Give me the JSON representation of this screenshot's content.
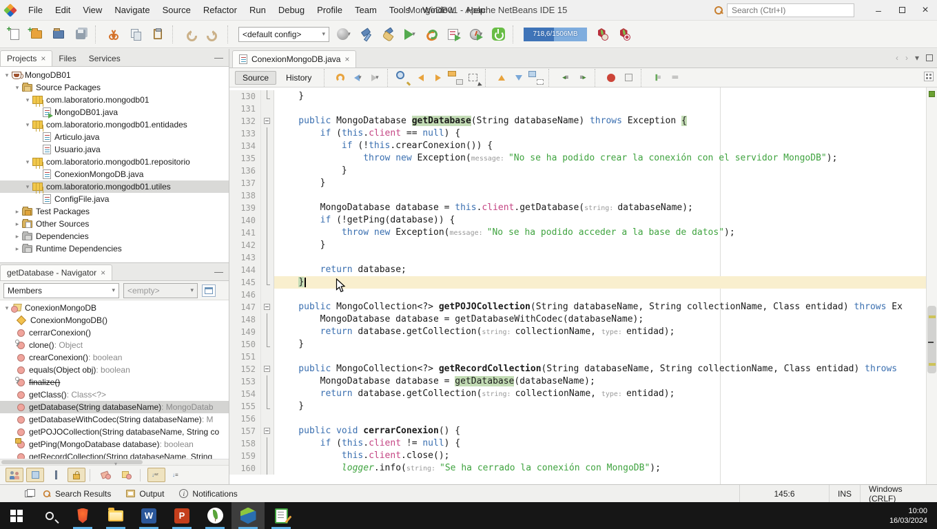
{
  "window": {
    "title": "MongoDB01 - Apache NetBeans IDE 15",
    "search_placeholder": "Search (Ctrl+I)"
  },
  "menu": {
    "items": [
      "File",
      "Edit",
      "View",
      "Navigate",
      "Source",
      "Refactor",
      "Run",
      "Debug",
      "Profile",
      "Team",
      "Tools",
      "Window",
      "Help"
    ]
  },
  "toolbar": {
    "config_value": "<default config>",
    "memory_text": "718,6/1506MB",
    "memory_fill_pct": 48,
    "icons": [
      "new-file",
      "new-project",
      "open-project",
      "save-all",
      "cut",
      "copy",
      "paste",
      "undo",
      "redo",
      "web-deploy",
      "build",
      "clean-build",
      "run",
      "rerun",
      "debug",
      "profile",
      "springboot",
      "mongo-start",
      "mongo-stop"
    ]
  },
  "projects_panel": {
    "tabs": [
      "Projects",
      "Files",
      "Services"
    ],
    "active_tab": "Projects",
    "tree": [
      {
        "indent": 0,
        "chevron": "open",
        "icon": "project",
        "label": "MongoDB01"
      },
      {
        "indent": 1,
        "chevron": "open",
        "icon": "src-folder",
        "label": "Source Packages"
      },
      {
        "indent": 2,
        "chevron": "open",
        "icon": "package",
        "label": "com.laboratorio.mongodb01"
      },
      {
        "indent": 3,
        "icon": "java-main",
        "label": "MongoDB01.java"
      },
      {
        "indent": 2,
        "chevron": "open",
        "icon": "package",
        "label": "com.laboratorio.mongodb01.entidades"
      },
      {
        "indent": 3,
        "icon": "java",
        "label": "Articulo.java"
      },
      {
        "indent": 3,
        "icon": "java",
        "label": "Usuario.java"
      },
      {
        "indent": 2,
        "chevron": "open",
        "icon": "package",
        "label": "com.laboratorio.mongodb01.repositorio"
      },
      {
        "indent": 3,
        "icon": "java",
        "label": "ConexionMongoDB.java"
      },
      {
        "indent": 2,
        "chevron": "open",
        "icon": "package",
        "label": "com.laboratorio.mongodb01.utiles",
        "selected": true
      },
      {
        "indent": 3,
        "icon": "java",
        "label": "ConfigFile.java"
      },
      {
        "indent": 1,
        "chevron": "closed",
        "icon": "test-folder",
        "label": "Test Packages"
      },
      {
        "indent": 1,
        "chevron": "closed",
        "icon": "other-folder",
        "label": "Other Sources"
      },
      {
        "indent": 1,
        "chevron": "closed",
        "icon": "deps",
        "label": "Dependencies"
      },
      {
        "indent": 1,
        "chevron": "closed",
        "icon": "deps",
        "label": "Runtime Dependencies"
      }
    ]
  },
  "navigator": {
    "tab_title": "getDatabase - Navigator",
    "filter_value": "Members",
    "secondary_value": "<empty>",
    "items": [
      {
        "icon": "class",
        "label": "ConexionMongoDB",
        "chevron": true
      },
      {
        "icon": "constructor",
        "label": "ConexionMongoDB()"
      },
      {
        "icon": "method",
        "label": "cerrarConexion()"
      },
      {
        "icon": "method-prot",
        "label": "clone()",
        "type": " : Object"
      },
      {
        "icon": "method",
        "label": "crearConexion()",
        "type": " : boolean"
      },
      {
        "icon": "method",
        "label": "equals(Object obj)",
        "type": " : boolean"
      },
      {
        "icon": "method-prot",
        "label": "finalize()",
        "strike": true
      },
      {
        "icon": "method",
        "label": "getClass()",
        "type": " : Class<?>"
      },
      {
        "icon": "method",
        "label": "getDatabase(String databaseName)",
        "type": " : MongoDatab",
        "selected": true
      },
      {
        "icon": "method",
        "label": "getDatabaseWithCodec(String databaseName)",
        "type": " : M"
      },
      {
        "icon": "method",
        "label": "getPOJOCollection(String databaseName, String co"
      },
      {
        "icon": "method-priv",
        "label": "getPing(MongoDatabase database)",
        "type": " : boolean"
      },
      {
        "icon": "method",
        "label": "getRecordCollection(String databaseName, String"
      }
    ],
    "filters": [
      {
        "name": "show-inherited",
        "pressed": true
      },
      {
        "name": "show-fields",
        "pressed": true
      },
      {
        "name": "show-static",
        "pressed": false
      },
      {
        "name": "show-non-public",
        "pressed": true
      },
      {
        "name": "filter-erasure",
        "pressed": false
      },
      {
        "name": "filter-inner-classes",
        "pressed": false
      },
      {
        "name": "sort-alphabetically",
        "pressed": true
      },
      {
        "name": "sort-by-source",
        "pressed": false
      }
    ]
  },
  "editor": {
    "tab_title": "ConexionMongoDB.java",
    "source_label": "Source",
    "history_label": "History",
    "lines": [
      {
        "n": 130,
        "f": "end",
        "t": [
          [
            "p",
            "    }"
          ]
        ]
      },
      {
        "n": 131,
        "t": []
      },
      {
        "n": 132,
        "f": "start",
        "t": [
          [
            "k",
            "    public"
          ],
          [
            "p",
            " MongoDatabase "
          ],
          [
            "b hl",
            "getDatabase"
          ],
          [
            "p",
            "(String databaseName) "
          ],
          [
            "k",
            "throws"
          ],
          [
            "p",
            " Exception "
          ],
          [
            "hl",
            "{"
          ]
        ]
      },
      {
        "n": 133,
        "f": "line",
        "t": [
          [
            "k",
            "        if"
          ],
          [
            "p",
            " ("
          ],
          [
            "k",
            "this"
          ],
          [
            "p",
            "."
          ],
          [
            "f",
            "client"
          ],
          [
            "p",
            " == "
          ],
          [
            "k",
            "null"
          ],
          [
            "p",
            ") {"
          ]
        ]
      },
      {
        "n": 134,
        "f": "line",
        "t": [
          [
            "k",
            "            if"
          ],
          [
            "p",
            " (!"
          ],
          [
            "k",
            "this"
          ],
          [
            "p",
            ".crearConexion()) {"
          ]
        ]
      },
      {
        "n": 135,
        "f": "line",
        "t": [
          [
            "k",
            "                throw"
          ],
          [
            "p",
            " "
          ],
          [
            "k",
            "new"
          ],
          [
            "p",
            " Exception("
          ],
          [
            "h",
            "message: "
          ],
          [
            "s",
            "\"No se ha podido crear la conexión con el servidor MongoDB\""
          ],
          [
            "p",
            ");"
          ]
        ]
      },
      {
        "n": 136,
        "f": "line",
        "t": [
          [
            "p",
            "            }"
          ]
        ]
      },
      {
        "n": 137,
        "f": "line",
        "t": [
          [
            "p",
            "        }"
          ]
        ]
      },
      {
        "n": 138,
        "f": "line",
        "t": []
      },
      {
        "n": 139,
        "f": "line",
        "t": [
          [
            "p",
            "        MongoDatabase database = "
          ],
          [
            "k",
            "this"
          ],
          [
            "p",
            "."
          ],
          [
            "f",
            "client"
          ],
          [
            "p",
            ".getDatabase("
          ],
          [
            "h",
            "string: "
          ],
          [
            "p",
            "databaseName);"
          ]
        ]
      },
      {
        "n": 140,
        "f": "line",
        "t": [
          [
            "k",
            "        if"
          ],
          [
            "p",
            " (!getPing(database)) {"
          ]
        ]
      },
      {
        "n": 141,
        "f": "line",
        "t": [
          [
            "k",
            "            throw"
          ],
          [
            "p",
            " "
          ],
          [
            "k",
            "new"
          ],
          [
            "p",
            " Exception("
          ],
          [
            "h",
            "message: "
          ],
          [
            "s",
            "\"No se ha podido acceder a la base de datos\""
          ],
          [
            "p",
            ");"
          ]
        ]
      },
      {
        "n": 142,
        "f": "line",
        "t": [
          [
            "p",
            "        }"
          ]
        ]
      },
      {
        "n": 143,
        "f": "line",
        "t": []
      },
      {
        "n": 144,
        "f": "line",
        "t": [
          [
            "k",
            "        return"
          ],
          [
            "p",
            " database;"
          ]
        ]
      },
      {
        "n": 145,
        "f": "end",
        "cur": true,
        "t": [
          [
            "p",
            "    "
          ],
          [
            "hl",
            "}"
          ]
        ]
      },
      {
        "n": 146,
        "t": []
      },
      {
        "n": 147,
        "f": "start",
        "t": [
          [
            "k",
            "    public"
          ],
          [
            "p",
            " MongoCollection<?> "
          ],
          [
            "b",
            "getPOJOCollection"
          ],
          [
            "p",
            "(String databaseName, String collectionName, Class entidad) "
          ],
          [
            "k",
            "throws"
          ],
          [
            "p",
            " Ex"
          ]
        ]
      },
      {
        "n": 148,
        "f": "line",
        "t": [
          [
            "p",
            "        MongoDatabase database = getDatabaseWithCodec(databaseName);"
          ]
        ]
      },
      {
        "n": 149,
        "f": "line",
        "t": [
          [
            "k",
            "        return"
          ],
          [
            "p",
            " database.getCollection("
          ],
          [
            "h",
            "string: "
          ],
          [
            "p",
            "collectionName, "
          ],
          [
            "h",
            "type: "
          ],
          [
            "p",
            "entidad);"
          ]
        ]
      },
      {
        "n": 150,
        "f": "end",
        "t": [
          [
            "p",
            "    }"
          ]
        ]
      },
      {
        "n": 151,
        "t": []
      },
      {
        "n": 152,
        "f": "start",
        "t": [
          [
            "k",
            "    public"
          ],
          [
            "p",
            " MongoCollection<?> "
          ],
          [
            "b",
            "getRecordCollection"
          ],
          [
            "p",
            "(String databaseName, String collectionName, Class entidad) "
          ],
          [
            "k",
            "throws"
          ]
        ]
      },
      {
        "n": 153,
        "f": "line",
        "t": [
          [
            "p",
            "        MongoDatabase database = "
          ],
          [
            "hl",
            "getDatabase"
          ],
          [
            "p",
            "(databaseName);"
          ]
        ]
      },
      {
        "n": 154,
        "f": "line",
        "t": [
          [
            "k",
            "        return"
          ],
          [
            "p",
            " database.getCollection("
          ],
          [
            "h",
            "string: "
          ],
          [
            "p",
            "collectionName, "
          ],
          [
            "h",
            "type: "
          ],
          [
            "p",
            "entidad);"
          ]
        ]
      },
      {
        "n": 155,
        "f": "end",
        "t": [
          [
            "p",
            "    }"
          ]
        ]
      },
      {
        "n": 156,
        "t": []
      },
      {
        "n": 157,
        "f": "start",
        "t": [
          [
            "k",
            "    public"
          ],
          [
            "p",
            " "
          ],
          [
            "k",
            "void"
          ],
          [
            "p",
            " "
          ],
          [
            "b",
            "cerrarConexion"
          ],
          [
            "p",
            "() {"
          ]
        ]
      },
      {
        "n": 158,
        "f": "line",
        "t": [
          [
            "k",
            "        if"
          ],
          [
            "p",
            " ("
          ],
          [
            "k",
            "this"
          ],
          [
            "p",
            "."
          ],
          [
            "f",
            "client"
          ],
          [
            "p",
            " != "
          ],
          [
            "k",
            "null"
          ],
          [
            "p",
            ") {"
          ]
        ]
      },
      {
        "n": 159,
        "f": "line",
        "t": [
          [
            "k",
            "            this"
          ],
          [
            "p",
            "."
          ],
          [
            "f",
            "client"
          ],
          [
            "p",
            ".close();"
          ]
        ]
      },
      {
        "n": 160,
        "f": "line",
        "t": [
          [
            "p",
            "            "
          ],
          [
            "g",
            "logger"
          ],
          [
            "p",
            ".info("
          ],
          [
            "h",
            "string: "
          ],
          [
            "s",
            "\"Se ha cerrado la conexión con MongoDB\""
          ],
          [
            "p",
            ");"
          ]
        ]
      }
    ]
  },
  "status_bar": {
    "items": [
      "Search Results",
      "Output",
      "Notifications"
    ],
    "caret_position": "145:6",
    "insert_mode": "INS",
    "line_ending": "Windows (CRLF)"
  },
  "taskbar": {
    "apps": [
      {
        "name": "start",
        "running": false
      },
      {
        "name": "taskbar-search",
        "running": false
      },
      {
        "name": "brave",
        "running": true
      },
      {
        "name": "file-explorer",
        "running": true
      },
      {
        "name": "word",
        "running": true
      },
      {
        "name": "powerpoint",
        "running": true
      },
      {
        "name": "mongodb",
        "running": true
      },
      {
        "name": "netbeans",
        "running": true,
        "active": true
      },
      {
        "name": "notepad-gnu",
        "running": true
      }
    ],
    "time": "10:00",
    "date": "16/03/2024"
  },
  "colors": {
    "keyword": "#3a6fb0",
    "string": "#3fa33f",
    "field": "#c44483",
    "occurrence_highlight": "#c3dcb5",
    "current_line": "#f9efce",
    "run_green": "#55ab4f",
    "taskbar_underline": "#5fb2e8"
  }
}
